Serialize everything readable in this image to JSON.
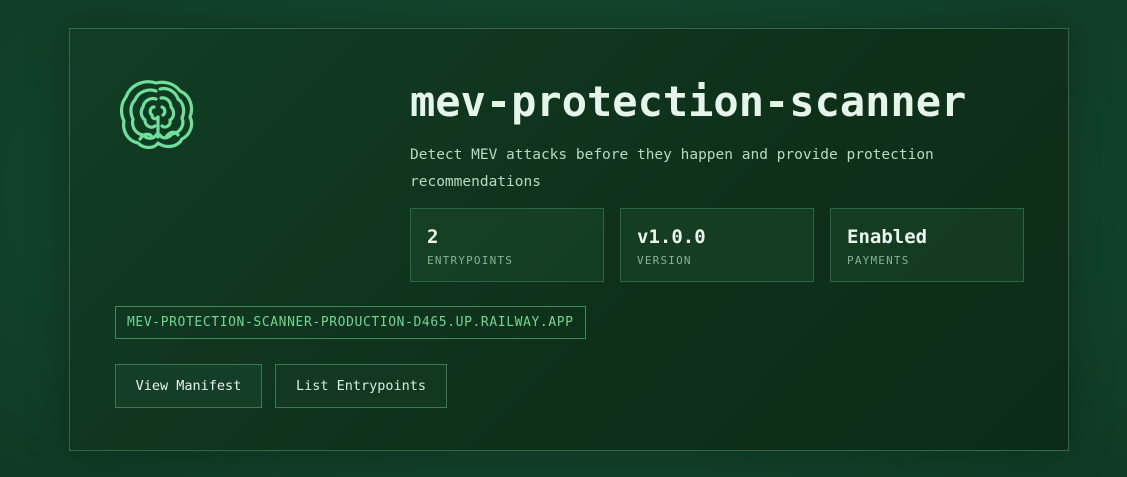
{
  "app": {
    "title": "mev-protection-scanner",
    "description": "Detect MEV attacks before they happen and provide protection recommendations",
    "url": "MEV-PROTECTION-SCANNER-PRODUCTION-D465.UP.RAILWAY.APP"
  },
  "stats": [
    {
      "value": "2",
      "label": "ENTRYPOINTS"
    },
    {
      "value": "v1.0.0",
      "label": "VERSION"
    },
    {
      "value": "Enabled",
      "label": "PAYMENTS"
    }
  ],
  "actions": {
    "view_manifest": "View Manifest",
    "list_entrypoints": "List Entrypoints"
  },
  "colors": {
    "accent": "#6fd694",
    "background": "#13462a",
    "card": "#0e3019"
  },
  "icons": {
    "logo": "brain-icon"
  }
}
